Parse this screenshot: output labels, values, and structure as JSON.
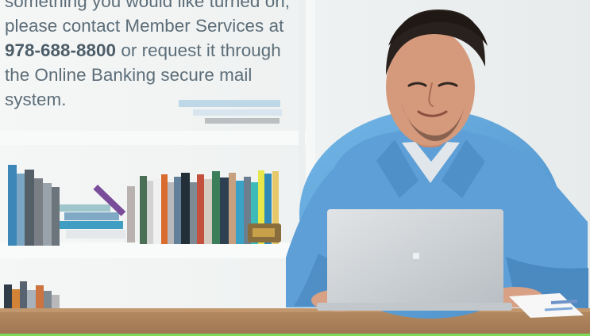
{
  "content": {
    "message_lines": [
      "something you would like turned on,",
      "please contact Member Services at",
      "978-688-8800",
      " or request it through",
      "the Online Banking secure mail",
      "system."
    ]
  },
  "colors": {
    "text": "#5c6d78",
    "accent_strip": "#7ed957",
    "shirt": "#5fa1d7",
    "laptop": "#c9ced2"
  },
  "image": {
    "subject": "man using laptop at desk"
  }
}
